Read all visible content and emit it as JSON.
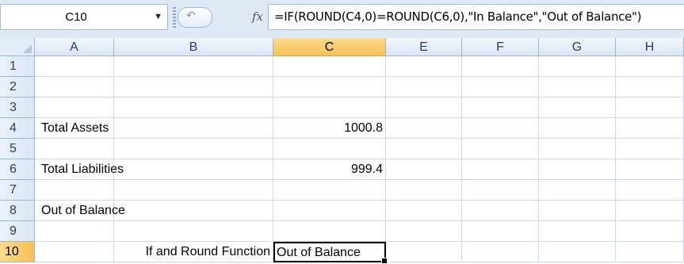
{
  "formula_bar": {
    "name_box": "C10",
    "fx_label": "fx",
    "formula": "=IF(ROUND(C4,0)=ROUND(C6,0),\"In Balance\",\"Out of Balance\")"
  },
  "columns": [
    "A",
    "B",
    "C",
    "E",
    "F",
    "G",
    "H"
  ],
  "rows": [
    "1",
    "2",
    "3",
    "4",
    "5",
    "6",
    "7",
    "8",
    "9",
    "10"
  ],
  "active_cell": "C10",
  "cells": {
    "A4": "Total Assets",
    "C4": "1000.8",
    "A6": "Total Liabilities",
    "C6": "999.4",
    "A8": "Out of Balance",
    "B10": "If and Round Function",
    "C10": "Out of Balance"
  }
}
